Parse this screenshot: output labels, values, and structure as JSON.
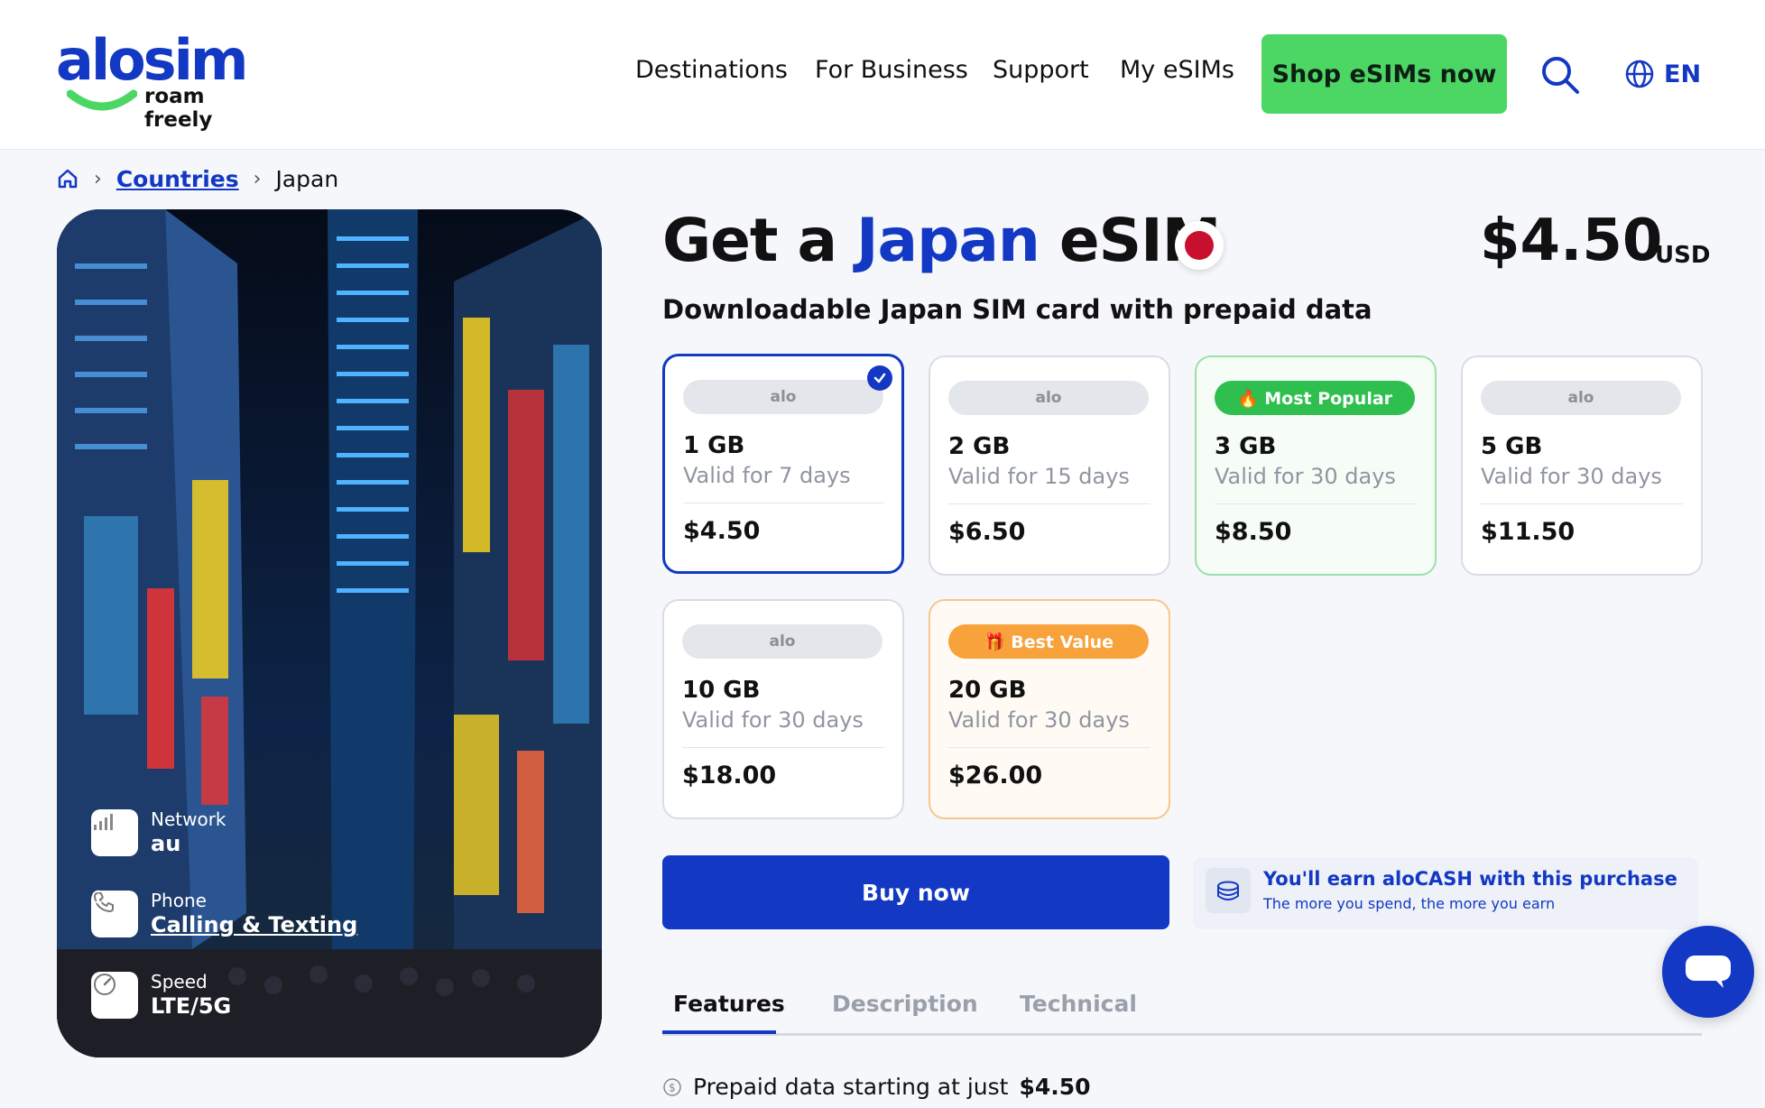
{
  "header": {
    "logo_text": "alosim",
    "logo_tagline": "roam freely",
    "nav": [
      "Destinations",
      "For Business",
      "Support",
      "My eSIMs"
    ],
    "cta": "Shop eSIMs now",
    "language": "EN",
    "icons": {
      "search": "search-icon",
      "language": "globe-icon"
    }
  },
  "breadcrumb": {
    "home_icon": "home-icon",
    "countries": "Countries",
    "current": "Japan"
  },
  "hero": {
    "network_label": "Network",
    "network_value": "au",
    "phone_label": "Phone",
    "phone_value": "Calling & Texting",
    "speed_label": "Speed",
    "speed_value": "LTE/5G",
    "icons": [
      "signal-icon",
      "phone-icon",
      "speedometer-icon",
      "info-icon"
    ]
  },
  "product": {
    "title_pre": "Get a",
    "title_accent": "Japan",
    "title_post": "eSIM",
    "price": "$4.50",
    "currency": "USD",
    "subtitle": "Downloadable Japan SIM card with prepaid data",
    "accent_color": "#1238c4"
  },
  "plans": [
    {
      "badge": "alo",
      "gb": "1 GB",
      "validity": "Valid for 7 days",
      "price": "$4.50",
      "selected": true
    },
    {
      "badge": "alo",
      "gb": "2 GB",
      "validity": "Valid for 15 days",
      "price": "$6.50"
    },
    {
      "badge": "🔥 Most Popular",
      "gb": "3 GB",
      "validity": "Valid for 30 days",
      "price": "$8.50"
    },
    {
      "badge": "alo",
      "gb": "5 GB",
      "validity": "Valid for 30 days",
      "price": "$11.50"
    },
    {
      "badge": "alo",
      "gb": "10 GB",
      "validity": "Valid for 30 days",
      "price": "$18.00"
    },
    {
      "badge": "🎁 Best Value",
      "gb": "20 GB",
      "validity": "Valid for 30 days",
      "price": "$26.00"
    }
  ],
  "buy": {
    "label": "Buy now"
  },
  "earn": {
    "title": "You'll earn aloCASH with this purchase",
    "subtitle": "The more you spend, the more you earn",
    "icon": "coins-icon"
  },
  "tabs": [
    "Features",
    "Description",
    "Technical"
  ],
  "feature_line": {
    "text": "Prepaid data starting at just",
    "value": "$4.50",
    "icon": "dollar-circle-icon"
  },
  "chat": {
    "icon": "chat-icon"
  }
}
